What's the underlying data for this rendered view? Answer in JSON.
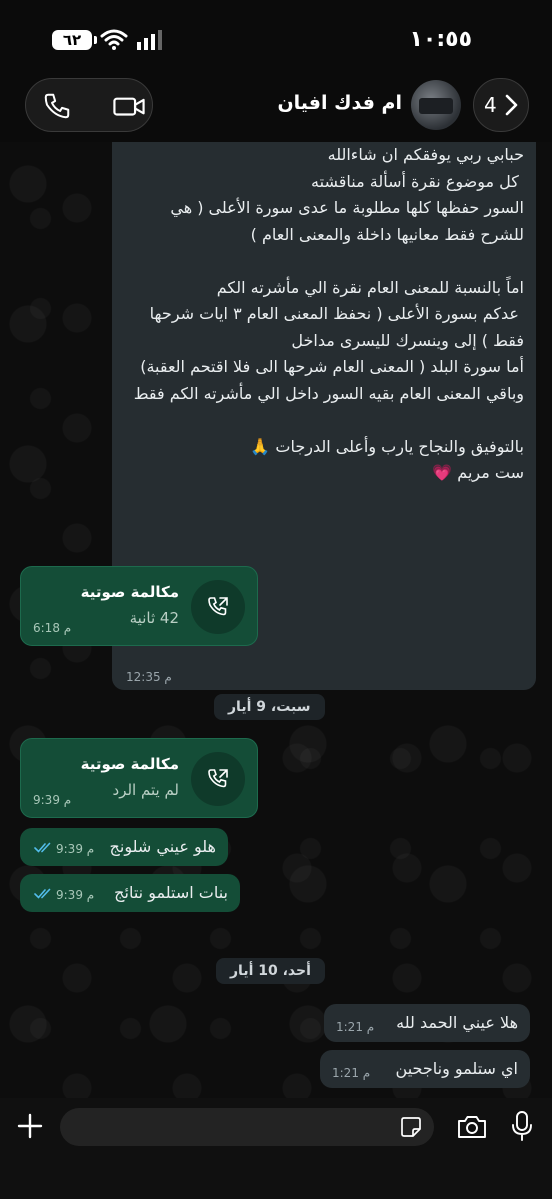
{
  "status_bar": {
    "time": "١٠:٥٥",
    "battery": "٦٢"
  },
  "header": {
    "contact_name": "ام فدك افيان",
    "unread_count": "4"
  },
  "messages": {
    "long": {
      "text": "حبابي ربي يوفقكم ان شاءالله\n كل موضوع نقرة أسألة مناقشته\nالسور حفظها كلها مطلوبة ما عدى سورة الأعلى ( هي للشرح فقط معانيها داخلة والمعنى العام )\n\nاماً بالنسبة للمعنى العام نقرة الي مأشرته الكم\n عدكم بسورة الأعلى ( نحفظ المعنى العام ٣ ايات شرحها فقط ) إلى وينسرك لليسرى مداخل\nأما سورة البلد ( المعنى العام شرحها الى فلا اقتحم العقبة)\nوباقي المعنى العام بقيه السور داخل الي مأشرته الكم فقط\n\nبالتوفيق والنجاح يارب وأعلى الدرجات 🙏\nست مريم 💗",
      "time": "12:35 م"
    },
    "call1": {
      "title": "مكالمة صوتية",
      "sub": "42 ثانية",
      "time": "6:18 م"
    },
    "date1": "سبت، 9 أيار",
    "call2": {
      "title": "مكالمة صوتية",
      "sub": "لم يتم الرد",
      "time": "9:39 م"
    },
    "out1": {
      "text": "هلو عيني شلونج",
      "time": "9:39 م"
    },
    "out2": {
      "text": "بنات استلمو نتائج",
      "time": "9:39 م"
    },
    "date2": "أحد، 10 أيار",
    "in1": {
      "text": "هلا عيني الحمد لله",
      "time": "1:21 م"
    },
    "in2": {
      "text": "اي ستلمو وناجحين",
      "time": "1:21 م"
    }
  },
  "icons": {
    "phone": "phone-icon",
    "video": "video-icon",
    "back": "chevron-icon",
    "plus": "plus-icon",
    "sticker": "sticker-icon",
    "camera": "camera-icon",
    "mic": "mic-icon",
    "call_out": "outgoing-call-icon",
    "read_ticks": "double-check-icon"
  },
  "colors": {
    "outgoing": "#144d37",
    "incoming": "#262d31",
    "ticks": "#53bdeb"
  }
}
